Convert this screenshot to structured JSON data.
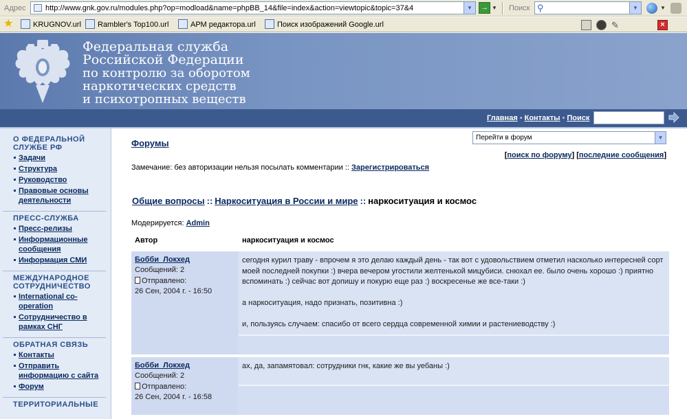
{
  "browser": {
    "address_label": "Адрес",
    "url": "http://www.gnk.gov.ru/modules.php?op=modload&name=phpBB_14&file=index&action=viewtopic&topic=37&4",
    "search_label": "Поиск",
    "links": [
      {
        "label": "KRUGNOV.url"
      },
      {
        "label": "Rambler's Top100.url"
      },
      {
        "label": "АРМ редактора.url"
      },
      {
        "label": "Поиск изображений Google.url"
      }
    ]
  },
  "header": {
    "title_lines": [
      "Федеральная служба",
      "Российской Федерации",
      "по контролю за оборотом",
      "наркотических средств",
      "и психотропных веществ"
    ],
    "nav": {
      "home": "Главная",
      "contacts": "Контакты",
      "search": "Поиск"
    }
  },
  "sidebar": {
    "sections": [
      {
        "title": "О ФЕДЕРАЛЬНОЙ СЛУЖБЕ РФ",
        "items": [
          "Задачи",
          "Структура",
          "Руководство",
          "Правовые основы деятельности"
        ]
      },
      {
        "title": "ПРЕСС-СЛУЖБА",
        "items": [
          "Пресс-релизы",
          "Информационные сообщения",
          "Информация СМИ"
        ]
      },
      {
        "title": "МЕЖДУНАРОДНОЕ СОТРУДНИЧЕСТВО",
        "items": [
          "International co-operation",
          "Сотрудничество в рамках СНГ"
        ]
      },
      {
        "title": "ОБРАТНАЯ СВЯЗЬ",
        "items": [
          "Контакты",
          "Отправить информацию с сайта",
          "Форум"
        ]
      },
      {
        "title": "ТЕРРИТОРИАЛЬНЫЕ",
        "items": []
      }
    ]
  },
  "forum": {
    "forums_link": "Форумы",
    "jump_select": "Перейти в форум",
    "search_forum": "поиск по форуму",
    "last_messages": "последние сообщения",
    "notice_text": "Замечание: без авторизации нельзя посылать комментарии ::",
    "register": "Зарегистрироваться",
    "breadcrumb": {
      "cat": "Общие вопросы",
      "forum": "Наркоситуация в России и мире",
      "topic": "наркоситуация и космос"
    },
    "moderated_label": "Модерируется:",
    "moderator": "Admin",
    "col_author": "Автор",
    "col_subject": "наркоситуация и космос",
    "posts": [
      {
        "author": "Бобби_Локхед",
        "messages": "Сообщений: 2",
        "sent_label": "Отправлено:",
        "date": "26 Сен, 2004 г. - 16:50",
        "paragraphs": [
          "сегодня курил траву - впрочем я это делаю каждый день - так вот с удовольствием отметил насколько интересней сорт моей последней покупки :) вчера вечером угостили желтенькой мицубиси. снюхал ее. было очень хорошо :) приятно вспоминать :) сейчас вот допишу и покурю еще раз :) воскресенье же все-таки :)",
          "а наркоситуация, надо признать, позитивна :)",
          "и, пользуясь случаем: спасибо от всего сердца современной химии и растениеводству :)"
        ]
      },
      {
        "author": "Бобби_Локхед",
        "messages": "Сообщений: 2",
        "sent_label": "Отправлено:",
        "date": "26 Сен, 2004 г. - 16:58",
        "paragraphs": [
          "ах, да, запамятовал: сотрудники гнк, какие же вы уебаны :)"
        ]
      }
    ]
  },
  "colors": {
    "header": "#6d88b8",
    "nav": "#3d5a8f",
    "sidebar": "#e3ebf6",
    "post_bg": "#d1dcf0",
    "link": "#0b2a60"
  }
}
